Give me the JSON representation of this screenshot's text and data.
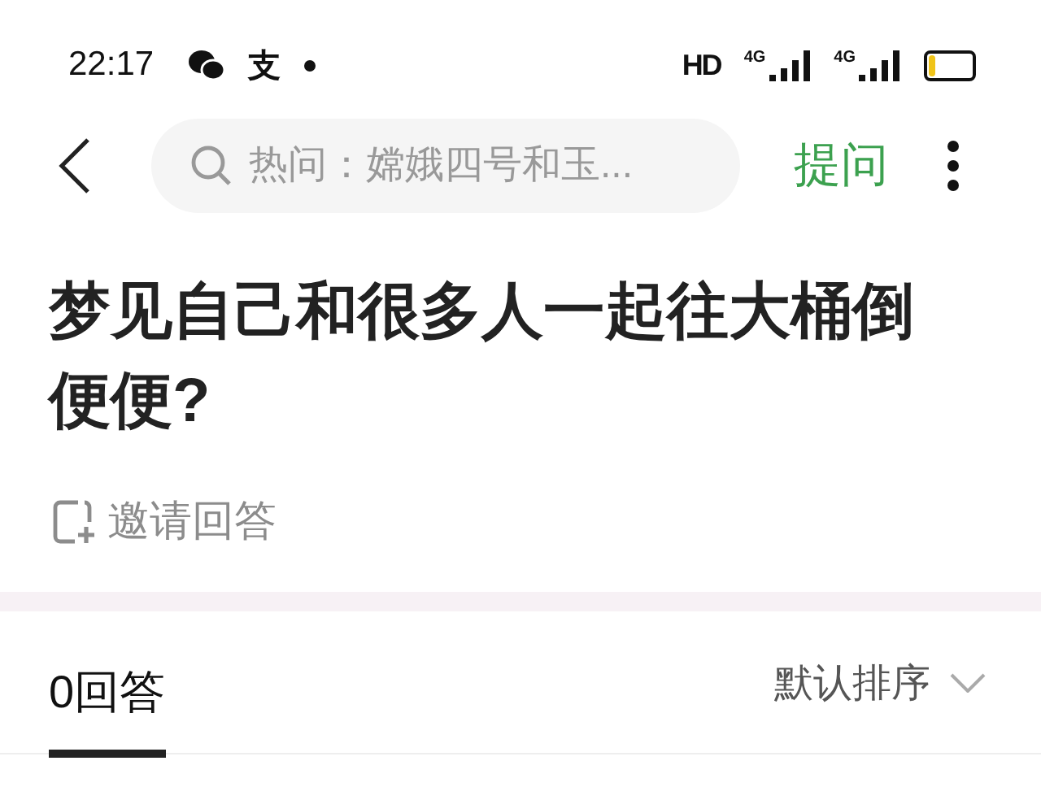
{
  "status_bar": {
    "time": "22:17",
    "app_glyph": "支",
    "hd": "HD",
    "networks": [
      "4G",
      "4G"
    ]
  },
  "header": {
    "search": {
      "placeholder": "热问：嫦娥四号和玉..."
    },
    "ask": "提问"
  },
  "question": {
    "title": "梦见自己和很多人一起往大桶倒便便?",
    "invite": "邀请回答"
  },
  "answers_bar": {
    "tab": {
      "label": "0回答",
      "selected": true
    },
    "sort": "默认排序"
  }
}
